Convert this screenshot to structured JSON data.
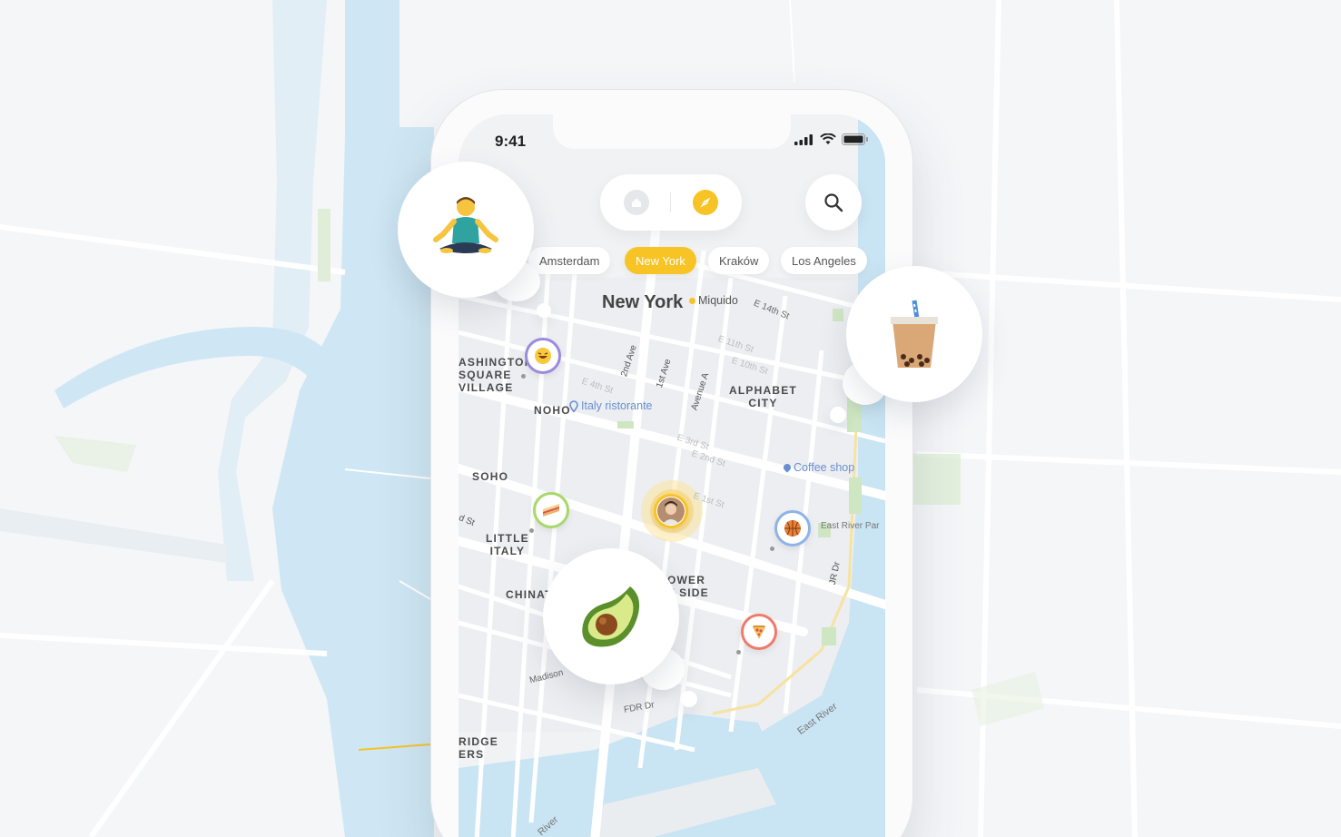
{
  "status_bar": {
    "time": "9:41"
  },
  "top_nav": {
    "home_icon": "home-icon",
    "explore_icon": "compass-icon",
    "search_icon": "search-icon",
    "accent": "#f7c325"
  },
  "city_chips": [
    {
      "label": "Amsterdam",
      "active": false
    },
    {
      "label": "New York",
      "active": true
    },
    {
      "label": "Kraków",
      "active": false
    },
    {
      "label": "Los Angeles",
      "active": false
    }
  ],
  "map": {
    "city_title": "New York",
    "company_marker": "Miquido",
    "districts": {
      "washington_square": "ASHINGTON\nSQUARE\nVILLAGE",
      "noho": "NOHO",
      "alphabet_city": "ALPHABET\nCITY",
      "soho": "SOHO",
      "little_italy": "LITTLE\nITALY",
      "chinatown": "CHINAT",
      "lower_east_side": "OWER\nT SIDE",
      "bridge": "RIDGE\nERS"
    },
    "streets": {
      "e14": "E 14th St",
      "ave2": "2nd Ave",
      "ave1": "1st Ave",
      "avea": "Avenue A",
      "e11": "E 11th St",
      "e10": "E 10th St",
      "e4": "E 4th St",
      "e3": "E 3rd St",
      "e2": "E 2nd St",
      "e1": "E 1st St",
      "dst": "d St",
      "madison": "Madison",
      "fdr": "FDR Dr",
      "jrdr": "JR Dr",
      "eastriverpark": "East River Par",
      "eastriver": "East River",
      "river": "River"
    },
    "pois": {
      "italy": "Italy ristorante",
      "coffee": "Coffee shop"
    },
    "colors": {
      "water": "#c9e4f3",
      "land": "#f2f3f5",
      "road": "#ffffff",
      "park": "#d8ebd1"
    }
  },
  "pins": {
    "laugh": "grinning-face-icon",
    "sandwich": "sandwich-icon",
    "user": "user-avatar",
    "ball": "basketball-icon",
    "pizza": "pizza-icon"
  },
  "bubbles": {
    "yoga": "meditation-person-icon",
    "tea": "bubble-tea-icon",
    "avocado": "avocado-icon"
  }
}
